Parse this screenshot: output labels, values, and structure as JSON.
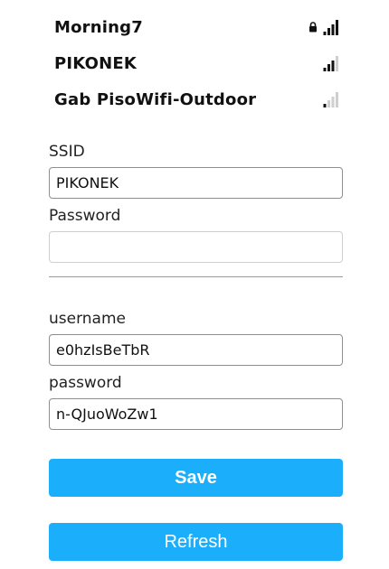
{
  "networks": [
    {
      "ssid": "Morning7",
      "secured": true,
      "signal": 4
    },
    {
      "ssid": "PIKONEK",
      "secured": false,
      "signal": 3
    },
    {
      "ssid": "Gab PisoWifi-Outdoor",
      "secured": false,
      "signal": 1
    }
  ],
  "form": {
    "ssid_label": "SSID",
    "ssid_value": "PIKONEK",
    "password_label": "Password",
    "password_value": "",
    "username_label": "username",
    "username_value": "e0hzIsBeTbR",
    "user_password_label": "password",
    "user_password_value": "n-QJuoWoZw1"
  },
  "buttons": {
    "save_label": "Save",
    "refresh_label": "Refresh"
  },
  "colors": {
    "button": "#1aaefb",
    "signal_on": "#111111",
    "signal_off": "#cfcfcf"
  }
}
